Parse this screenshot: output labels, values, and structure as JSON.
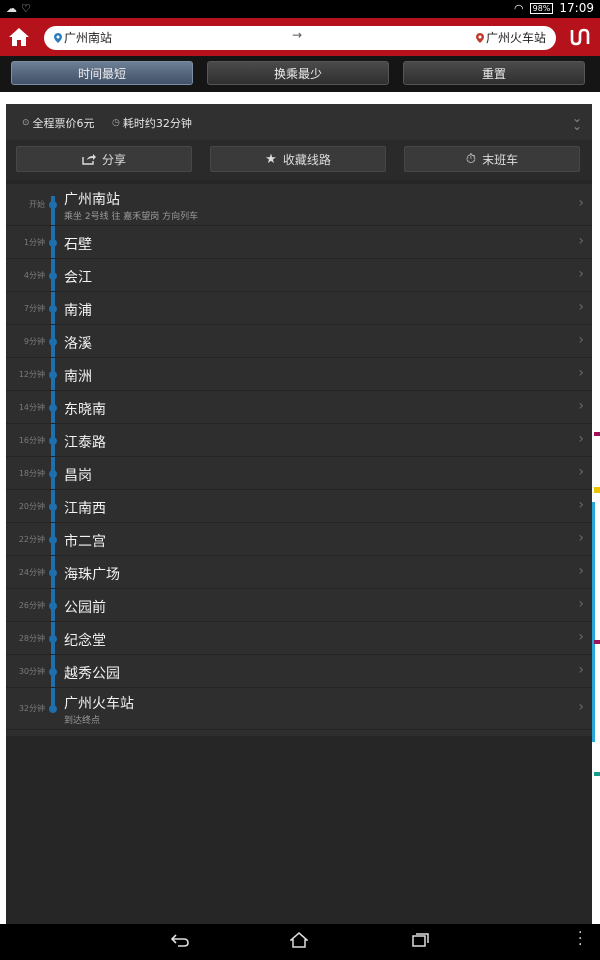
{
  "status_bar": {
    "left_icons": [
      "cloud-icon",
      "shield-icon"
    ],
    "battery": "98%",
    "time": "17:09"
  },
  "header": {
    "from_station": "广州南站",
    "to_station": "广州火车站",
    "arrow": "→",
    "swap_symbol": "ᑌᑎ"
  },
  "tabs": [
    {
      "label": "时间最短",
      "active": true
    },
    {
      "label": "换乘最少",
      "active": false
    },
    {
      "label": "重置",
      "active": false
    }
  ],
  "summary": {
    "fare": "全程票价6元",
    "duration": "耗时约32分钟"
  },
  "actions": {
    "share": "分享",
    "favorite": "收藏线路",
    "last_train": "末班车"
  },
  "route": {
    "line_color": "#1e6fae",
    "stations": [
      {
        "time": "开始",
        "name": "广州南站",
        "sub": "乘坐 2号线 往 嘉禾望岗 方向列车"
      },
      {
        "time": "1分钟",
        "name": "石壁"
      },
      {
        "time": "4分钟",
        "name": "会江"
      },
      {
        "time": "7分钟",
        "name": "南浦"
      },
      {
        "time": "9分钟",
        "name": "洛溪"
      },
      {
        "time": "12分钟",
        "name": "南洲"
      },
      {
        "time": "14分钟",
        "name": "东晓南"
      },
      {
        "time": "16分钟",
        "name": "江泰路"
      },
      {
        "time": "18分钟",
        "name": "昌岗"
      },
      {
        "time": "20分钟",
        "name": "江南西"
      },
      {
        "time": "22分钟",
        "name": "市二宫"
      },
      {
        "time": "24分钟",
        "name": "海珠广场"
      },
      {
        "time": "26分钟",
        "name": "公园前"
      },
      {
        "time": "28分钟",
        "name": "纪念堂"
      },
      {
        "time": "30分钟",
        "name": "越秀公园"
      },
      {
        "time": "32分钟",
        "name": "广州火车站",
        "sub": "到达终点"
      }
    ]
  },
  "colors": {
    "brand_red": "#b5121b",
    "panel_bg": "#262626"
  }
}
